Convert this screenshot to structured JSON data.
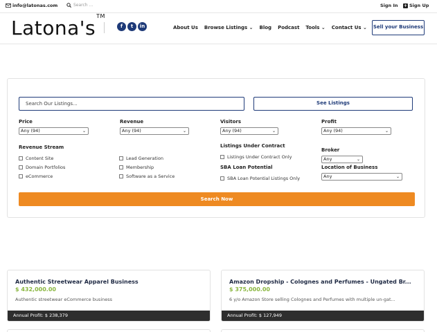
{
  "topbar": {
    "email": "info@latonas.com",
    "search_placeholder": "Search ...",
    "signin": "Sign In",
    "signup": "Sign Up"
  },
  "header": {
    "logo": "Latona's",
    "logo_tm": "TM",
    "social": [
      "f",
      "t",
      "in"
    ],
    "nav": [
      "About Us",
      "Browse Listings ⌄",
      "Blog",
      "Podcast",
      "Tools ⌄",
      "Contact Us ⌄"
    ],
    "sell_button": "Sell your Business"
  },
  "filters": {
    "search_placeholder": "Search Our Listings...",
    "see_listings": "See Listings",
    "price_label": "Price",
    "price_value": "Any (94)",
    "revenue_label": "Revenue",
    "revenue_value": "Any (94)",
    "visitors_label": "Visitors",
    "visitors_value": "Any (94)",
    "profit_label": "Profit",
    "profit_value": "Any (94)",
    "revenue_stream_label": "Revenue Stream",
    "revenue_streams": [
      "Content Site",
      "Domain Portfolios",
      "eCommerce",
      "Lead Generation",
      "Membership",
      "Software as a Service"
    ],
    "under_contract_label": "Listings Under Contract",
    "under_contract_option": "Listings Under Contract Only",
    "sba_label": "SBA Loan Potential",
    "sba_option": "SBA Loan Potential Listings Only",
    "broker_label": "Broker",
    "broker_value": "Any",
    "location_label": "Location of Business",
    "location_value": "Any",
    "search_now": "Search Now"
  },
  "listings": [
    {
      "title": "Authentic Streetwear Apparel Business",
      "price": "$ 432,000.00",
      "desc": "Authentic streetwear eCommerce business",
      "profit": "Annual Profit: $ 238,379"
    },
    {
      "title": "Amazon Dropship - Colognes and Perfumes - Ungated Br...",
      "price": "$ 375,000.00",
      "desc": "6 y/o Amazon Store selling Colognes and Perfumes with multiple un-gat...",
      "profit": "Annual Profit: $ 127,949"
    }
  ],
  "colors": {
    "brand_navy": "#1e3a78",
    "accent_orange": "#ee8a22",
    "price_green": "#8ab640"
  }
}
